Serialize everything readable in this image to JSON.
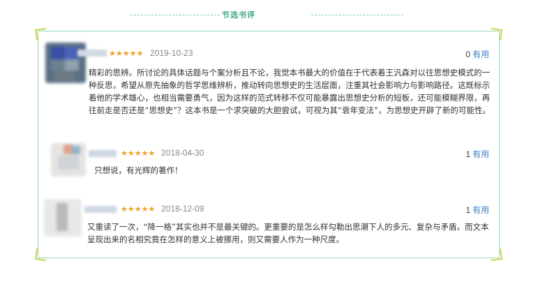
{
  "section_title": "节选书评",
  "reviews": [
    {
      "stars": "★★★★★",
      "date": "2019-10-23",
      "useful_count": "0",
      "useful_label": "有用",
      "text": "精彩的思辨。所讨论的具体话题与个案分析且不论，我觉本书最大的价值在于代表着王汎森对以往思想史模式的一种反思，希望从原先抽象的哲学思维辨析，推动转向思想史的生活层面，注重其社会影响力与影响路径。这既标示着他的学术雄心，也相当需要勇气，因为这样的范式转移不仅可能暴露出思想史分析的短板，还可能模糊界限，再往前走是否还是“思想史”？这本书是一个求突破的大胆尝试，可视为其“衰年变法”，为思想史开辟了新的可能性。"
    },
    {
      "stars": "★★★★★",
      "date": "2018-04-30",
      "useful_count": "1",
      "useful_label": "有用",
      "text": "只想说，有光辉的著作！"
    },
    {
      "stars": "★★★★★",
      "date": "2018-12-09",
      "useful_count": "1",
      "useful_label": "有用",
      "text": "又重读了一次，“降一格”其实也并不是最关键的。更重要的是怎么样勾勒出思潮下人的多元、复杂与矛盾。而文本呈现出来的名相究竟在怎样的意义上被挪用，则又需要人作为一种尺度。"
    }
  ]
}
